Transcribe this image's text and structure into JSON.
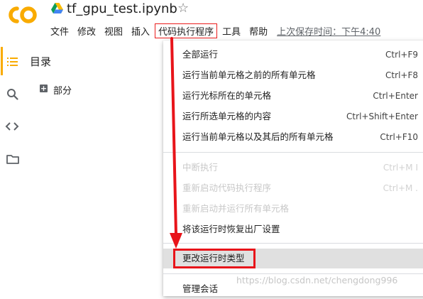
{
  "header": {
    "notebook_title": "tf_gpu_test.ipynb",
    "menus": [
      "文件",
      "修改",
      "视图",
      "插入",
      "代码执行程序",
      "工具",
      "帮助"
    ],
    "active_menu_index": 4,
    "last_saved": "上次保存时间：下午4:40"
  },
  "toc": {
    "title": "目录",
    "section_toggle": "+",
    "section_label": "部分"
  },
  "dropdown": {
    "items": [
      {
        "label": "全部运行",
        "shortcut": "Ctrl+F9",
        "state": "enabled"
      },
      {
        "label": "运行当前单元格之前的所有单元格",
        "shortcut": "Ctrl+F8",
        "state": "enabled"
      },
      {
        "label": "运行光标所在的单元格",
        "shortcut": "Ctrl+Enter",
        "state": "enabled"
      },
      {
        "label": "运行所选单元格的内容",
        "shortcut": "Ctrl+Shift+Enter",
        "state": "enabled"
      },
      {
        "label": "运行当前单元格以及其后的所有单元格",
        "shortcut": "Ctrl+F10",
        "state": "enabled"
      },
      {
        "label": "中断执行",
        "shortcut": "Ctrl+M I",
        "state": "disabled"
      },
      {
        "label": "重新启动代码执行程序",
        "shortcut": "Ctrl+M .",
        "state": "disabled"
      },
      {
        "label": "重新启动并运行所有单元格",
        "shortcut": "",
        "state": "disabled"
      },
      {
        "label": "将该运行时恢复出厂设置",
        "shortcut": "",
        "state": "enabled"
      },
      {
        "label": "更改运行时类型",
        "shortcut": "",
        "state": "highlighted"
      },
      {
        "label": "管理会话",
        "shortcut": "",
        "state": "enabled"
      }
    ]
  },
  "watermark": "https://blog.csdn.net/chengdong996",
  "colors": {
    "logo_orange": "#f9ab00",
    "annotation_red": "#e8141a",
    "disabled_text": "#c8c8c8",
    "highlight_bg": "#e0e0e0"
  },
  "icons": [
    "colab-logo-icon",
    "drive-icon",
    "star-icon",
    "toc-icon",
    "search-icon",
    "code-icon",
    "folder-icon"
  ]
}
